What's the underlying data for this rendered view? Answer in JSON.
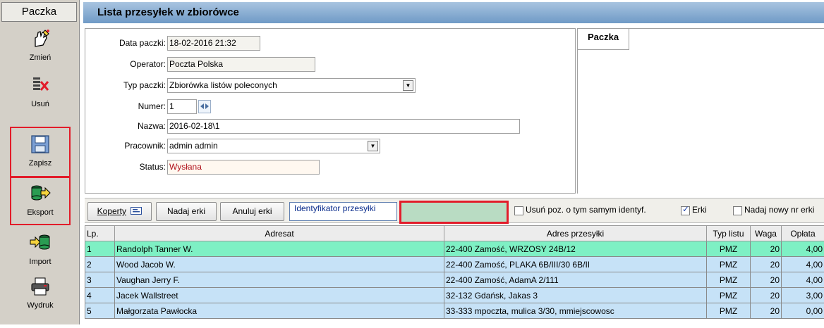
{
  "sidebar": {
    "header": "Paczka",
    "buttons": [
      {
        "label": "Zmień",
        "icon": "edit-hand-icon"
      },
      {
        "label": "Usuń",
        "icon": "delete-icon"
      },
      {
        "label": "Zapisz",
        "icon": "save-floppy-icon"
      },
      {
        "label": "Eksport",
        "icon": "export-icon"
      },
      {
        "label": "Import",
        "icon": "import-icon"
      },
      {
        "label": "Wydruk",
        "icon": "printer-icon"
      }
    ]
  },
  "window": {
    "title": "Lista przesyłek w zbiorówce"
  },
  "form": {
    "data_paczki_label": "Data paczki:",
    "data_paczki_value": "18-02-2016  21:32",
    "operator_label": "Operator:",
    "operator_value": "Poczta Polska",
    "typ_label": "Typ paczki:",
    "typ_value": "Zbiorówka listów poleconych",
    "numer_label": "Numer:",
    "numer_value": "1",
    "nazwa_label": "Nazwa:",
    "nazwa_value": "2016-02-18\\1",
    "pracownik_label": "Pracownik:",
    "pracownik_value": "admin admin",
    "status_label": "Status:",
    "status_value": "Wysłana"
  },
  "tab": {
    "label": "Paczka"
  },
  "toolbar": {
    "koperty_label": "Koperty",
    "nadaj_label": "Nadaj erki",
    "anuluj_label": "Anuluj erki",
    "ident_label": "Identyfikator przesyłki",
    "ident_value": "",
    "usun_label": "Usuń poz. o tym samym identyf.",
    "usun_checked": false,
    "erki_label": "Erki",
    "erki_checked": true,
    "nadaj_nowy_label": "Nadaj nowy nr erki"
  },
  "grid": {
    "columns": [
      "Lp.",
      "Adresat",
      "Adres przesyłki",
      "Typ listu",
      "Waga",
      "Opłata"
    ],
    "rows": [
      {
        "lp": "1",
        "adresat": "Randolph Tanner W.",
        "adres": "22-400  Zamość, WRZOSY 24B/12",
        "typ": "PMZ",
        "waga": "20",
        "oplata": "4,00",
        "selected": true
      },
      {
        "lp": "2",
        "adresat": "Wood Jacob W.",
        "adres": "22-400  Zamość, PLAKA 6B/III/30 6B/II",
        "typ": "PMZ",
        "waga": "20",
        "oplata": "4,00",
        "selected": false
      },
      {
        "lp": "3",
        "adresat": "Vaughan Jerry F.",
        "adres": "22-400  Zamość, AdamA 2/111",
        "typ": "PMZ",
        "waga": "20",
        "oplata": "4,00",
        "selected": false
      },
      {
        "lp": "4",
        "adresat": "Jacek Wallstreet",
        "adres": "32-132  Gdańsk, Jakas 3",
        "typ": "PMZ",
        "waga": "20",
        "oplata": "3,00",
        "selected": false
      },
      {
        "lp": "5",
        "adresat": "Małgorzata Pawłocka",
        "adres": "33-333  mpoczta, mulica 3/30, mmiejscowosc",
        "typ": "PMZ",
        "waga": "20",
        "oplata": "0,00",
        "selected": false
      }
    ]
  },
  "colors": {
    "highlight": "#e21c2a",
    "selected_row": "#7ef0c4",
    "row": "#c6e2f7",
    "title_bar": "#6f9ac6"
  }
}
